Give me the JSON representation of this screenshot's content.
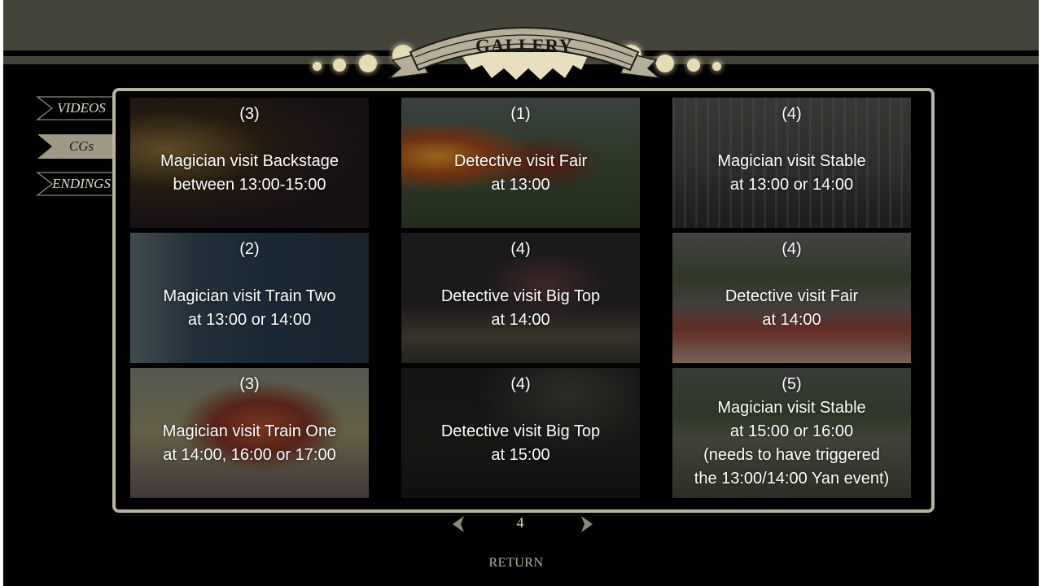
{
  "header": {
    "title": "GALLERY"
  },
  "sidebar": {
    "tabs": [
      {
        "label": "VIDEOS",
        "active": false
      },
      {
        "label": "CGs",
        "active": true
      },
      {
        "label": "ENDINGS",
        "active": false
      }
    ]
  },
  "gallery": {
    "items": [
      {
        "number": "(3)",
        "description": "Magician visit Backstage\nbetween 13:00-15:00",
        "scene": "backstage"
      },
      {
        "number": "(1)",
        "description": "Detective visit Fair\nat 13:00",
        "scene": "fair-fire"
      },
      {
        "number": "(4)",
        "description": "Magician visit Stable\nat 13:00 or 14:00",
        "scene": "stable-cage"
      },
      {
        "number": "(2)",
        "description": "Magician visit Train Two\nat 13:00 or 14:00",
        "scene": "train-two"
      },
      {
        "number": "(4)",
        "description": "Detective visit Big Top\nat 14:00",
        "scene": "big-top-ringmaster"
      },
      {
        "number": "(4)",
        "description": "Detective visit Fair\nat 14:00",
        "scene": "fair-elephant"
      },
      {
        "number": "(3)",
        "description": "Magician visit Train One\nat 14:00, 16:00 or 17:00",
        "scene": "train-one"
      },
      {
        "number": "(4)",
        "description": "Detective visit Big Top\nat 15:00",
        "scene": "big-top-night"
      },
      {
        "number": "(5)",
        "description": "Magician visit Stable\nat 15:00 or 16:00\n(needs to have triggered\nthe 13:00/14:00  Yan event)",
        "scene": "stable-outside"
      }
    ]
  },
  "pagination": {
    "current_page": "4",
    "prev_icon": "chevron-left-icon",
    "next_icon": "chevron-right-icon"
  },
  "footer": {
    "return_label": "RETURN"
  },
  "colors": {
    "header_bg": "#45443a",
    "accent": "#b9b49f",
    "banner_fill": "#b5ae98",
    "dot": "#e6dcb4"
  }
}
